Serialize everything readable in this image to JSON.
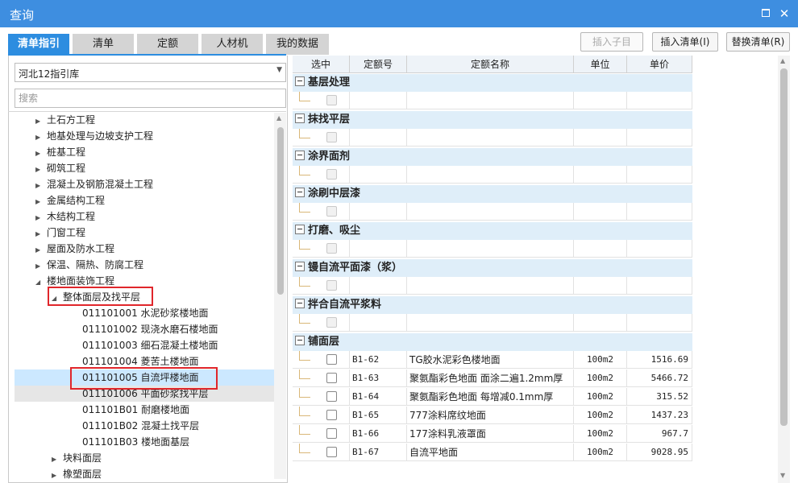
{
  "window": {
    "title": "查询"
  },
  "tabs": [
    "清单指引",
    "清单",
    "定额",
    "人材机",
    "我的数据"
  ],
  "buttons": {
    "insert_child": "插入子目",
    "insert_list": "插入清单(I)",
    "replace_list": "替换清单(R)"
  },
  "library_select": {
    "value": "河北12指引库"
  },
  "search": {
    "placeholder": "搜索"
  },
  "tree": [
    "土石方工程",
    "地基处理与边坡支护工程",
    "桩基工程",
    "砌筑工程",
    "混凝土及钢筋混凝土工程",
    "金属结构工程",
    "木结构工程",
    "门窗工程",
    "屋面及防水工程",
    "保温、隔热、防腐工程",
    "楼地面装饰工程",
    "整体面层及找平层",
    "011101001  水泥砂浆楼地面",
    "011101002  现浇水磨石楼地面",
    "011101003  细石混凝土楼地面",
    "011101004  菱苦土楼地面",
    "011101005  自流坪楼地面",
    "011101006  平面砂浆找平层",
    "011101B01  耐磨楼地面",
    "011101B02  混凝土找平层",
    "011101B03  楼地面基层",
    "块料面层",
    "橡塑面层"
  ],
  "grid": {
    "headers": [
      "选中",
      "定额号",
      "定额名称",
      "单位",
      "单价"
    ],
    "groups": [
      "基层处理",
      "抹找平层",
      "涂界面剂",
      "涂刷中层漆",
      "打磨、吸尘",
      "镘自流平面漆（浆）",
      "拌合自流平浆料",
      "铺面层"
    ],
    "rows": [
      {
        "code": "B1-62",
        "name": "TG胶水泥彩色楼地面",
        "unit": "100m2",
        "price": "1516.69"
      },
      {
        "code": "B1-63",
        "name": "聚氨酯彩色地面 面涂二遍1.2mm厚",
        "unit": "100m2",
        "price": "5466.72"
      },
      {
        "code": "B1-64",
        "name": "聚氨酯彩色地面 每增减0.1mm厚",
        "unit": "100m2",
        "price": "315.52"
      },
      {
        "code": "B1-65",
        "name": "777涂料席纹地面",
        "unit": "100m2",
        "price": "1437.23"
      },
      {
        "code": "B1-66",
        "name": "177涂料乳液罩面",
        "unit": "100m2",
        "price": "967.7"
      },
      {
        "code": "B1-67",
        "name": "自流平地面",
        "unit": "100m2",
        "price": "9028.95"
      }
    ]
  },
  "colors": {
    "titlebar": "#3e8ee0",
    "accent": "#2d8de0",
    "highlight": "#cce8ff",
    "red_box": "#e0262b",
    "group_bg": "#dfeef9"
  }
}
